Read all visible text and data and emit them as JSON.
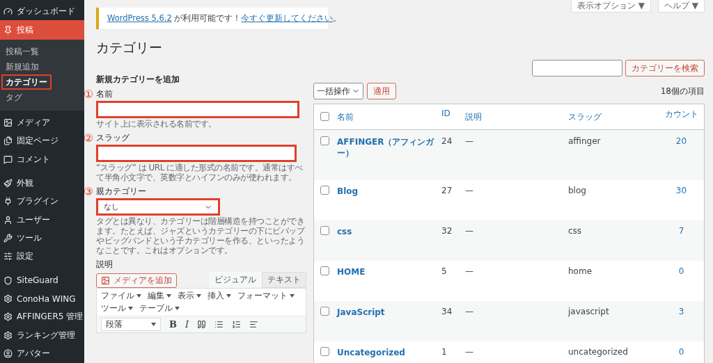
{
  "sidebar": {
    "items": [
      {
        "label": "ダッシュボード",
        "selected": false
      },
      {
        "label": "投稿",
        "selected": true,
        "children": [
          {
            "label": "投稿一覧",
            "selected": false,
            "highlighted": false
          },
          {
            "label": "新規追加",
            "selected": false,
            "highlighted": false
          },
          {
            "label": "カテゴリー",
            "selected": true,
            "highlighted": true
          },
          {
            "label": "タグ",
            "selected": false,
            "highlighted": false
          }
        ]
      },
      {
        "label": "メディア",
        "selected": false
      },
      {
        "label": "固定ページ",
        "selected": false
      },
      {
        "label": "コメント",
        "selected": false
      },
      {
        "label": "外観",
        "selected": false
      },
      {
        "label": "プラグイン",
        "selected": false
      },
      {
        "label": "ユーザー",
        "selected": false
      },
      {
        "label": "ツール",
        "selected": false
      },
      {
        "label": "設定",
        "selected": false
      },
      {
        "label": "SiteGuard",
        "selected": false
      },
      {
        "label": "ConoHa WING",
        "selected": false
      },
      {
        "label": "AFFINGER5 管理",
        "selected": false
      },
      {
        "label": "ランキング管理",
        "selected": false
      },
      {
        "label": "アバター",
        "selected": false
      }
    ]
  },
  "screen_buttons": [
    "表示オプション ▼",
    "ヘルプ ▼"
  ],
  "notice": {
    "link": "WordPress 5.6.2",
    "text": " が利用可能です！",
    "action": "今すぐ更新してください",
    "end": "。"
  },
  "title": "カテゴリー",
  "form": {
    "heading": "新規カテゴリーを追加",
    "fields": [
      {
        "kind": "text",
        "marker": "①",
        "label": "名前",
        "highlighted": true,
        "help": "サイト上に表示される名前です。"
      },
      {
        "kind": "text",
        "marker": "②",
        "label": "スラッグ",
        "highlighted": true,
        "help": "“スラッグ” は URL に適した形式の名前です。通常はすべて半角小文字で、英数字とハイフンのみが使われます。"
      },
      {
        "kind": "select",
        "marker": "③",
        "label": "親カテゴリー",
        "value": "なし",
        "highlighted": true,
        "help": "タグとは異なり、カテゴリーは階層構造を持つことができます。たとえば、ジャズというカテゴリーの下にビバップやビッグバンドという子カテゴリーを作る、といったようなことです。これはオプションです。"
      }
    ],
    "description": {
      "label": "説明",
      "media_button": "メディアを追加",
      "tabs": [
        {
          "label": "ビジュアル",
          "selected": true
        },
        {
          "label": "テキスト",
          "selected": false
        }
      ],
      "menus": [
        "ファイル",
        "編集",
        "表示",
        "挿入",
        "フォーマット",
        "ツール",
        "テーブル"
      ],
      "block_format": "段落",
      "format_buttons": [
        {
          "kind": "bold",
          "label": "B"
        },
        {
          "kind": "italic",
          "label": "I"
        },
        {
          "kind": "quote"
        },
        {
          "kind": "bullets"
        },
        {
          "kind": "numbers"
        },
        {
          "kind": "align"
        }
      ]
    }
  },
  "search": {
    "button": "カテゴリーを検索"
  },
  "bulk": {
    "select": "一括操作",
    "apply": "適用",
    "count": "18個の項目"
  },
  "table": {
    "select_all_checked": false,
    "columns": [
      "名前",
      "ID",
      "説明",
      "スラッグ",
      "カウント"
    ],
    "rows": [
      {
        "name": "AFFINGER（アフィンガー）",
        "id": "24",
        "description": "—",
        "slug": "affinger",
        "count": "20",
        "checked": false
      },
      {
        "name": "Blog",
        "id": "27",
        "description": "—",
        "slug": "blog",
        "count": "30",
        "checked": false
      },
      {
        "name": "css",
        "id": "32",
        "description": "—",
        "slug": "css",
        "count": "7",
        "checked": false
      },
      {
        "name": "HOME",
        "id": "5",
        "description": "—",
        "slug": "home",
        "count": "0",
        "checked": false
      },
      {
        "name": "JavaScript",
        "id": "34",
        "description": "—",
        "slug": "javascript",
        "count": "3",
        "checked": false
      },
      {
        "name": "Uncategorized",
        "id": "1",
        "description": "—",
        "slug": "uncategorized",
        "count": "0",
        "checked": false
      }
    ]
  }
}
